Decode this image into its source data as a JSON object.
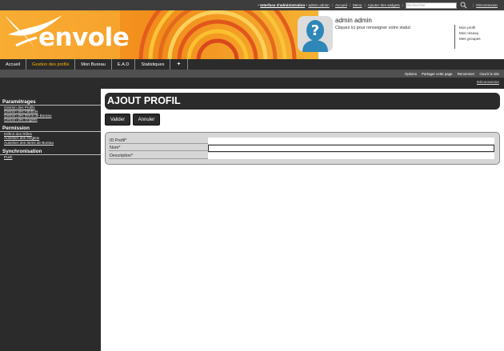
{
  "topbar": {
    "admin_link": "Interface d'administration",
    "user_link": "admin admin",
    "links": [
      "Accueil",
      "Menu",
      "Ajouter des widgets"
    ],
    "search_placeholder": "Rechercher",
    "logout": "Déconnexion",
    "icons": {
      "search": "search-icon"
    }
  },
  "banner": {
    "logo_text": "envole",
    "user_name": "admin admin",
    "user_status": "Cliquez ici pour renseigner votre statut",
    "profile_links": [
      "Mon profil",
      "Mon réseau",
      "Mes groupes"
    ],
    "colors": {
      "orange": "#f28c1b",
      "light_orange": "#f9c12e",
      "red": "#d9481c"
    }
  },
  "mainnav": {
    "tabs": [
      {
        "label": "Accueil",
        "active": false
      },
      {
        "label": "Gestion des profils",
        "active": true
      },
      {
        "label": "Mon Bureau",
        "active": false
      },
      {
        "label": "E.A.D",
        "active": false
      },
      {
        "label": "Statistiques",
        "active": false
      },
      {
        "label": "+",
        "active": false
      }
    ],
    "active_color": "#ffb100"
  },
  "subnav": {
    "items": [
      "Options",
      "Partager cette page",
      "Renommer",
      "Ouvrir le site"
    ]
  },
  "logoutbar": {
    "label": "Déconnexion"
  },
  "sidebar": {
    "sections": [
      {
        "title": "Paramétrages",
        "links": [
          "Gestion des Profils",
          "Gestion des Attributs",
          "Gestion des Items de Bureau",
          "Gestion des Onglets"
        ]
      },
      {
        "title": "Permission",
        "links": [
          "Définir des Rôles",
          "Autoriser des Onglets",
          "Autoriser des Items de Bureau"
        ]
      },
      {
        "title": "Synchronisation",
        "links": [
          "Push"
        ]
      }
    ]
  },
  "content": {
    "title": "AJOUT PROFIL",
    "buttons": {
      "valider": "Valider",
      "annuler": "Annuler"
    },
    "fields": [
      {
        "label": "ID Profil*",
        "value": ""
      },
      {
        "label": "Nom*",
        "value": ""
      },
      {
        "label": "Description*",
        "value": ""
      }
    ]
  }
}
